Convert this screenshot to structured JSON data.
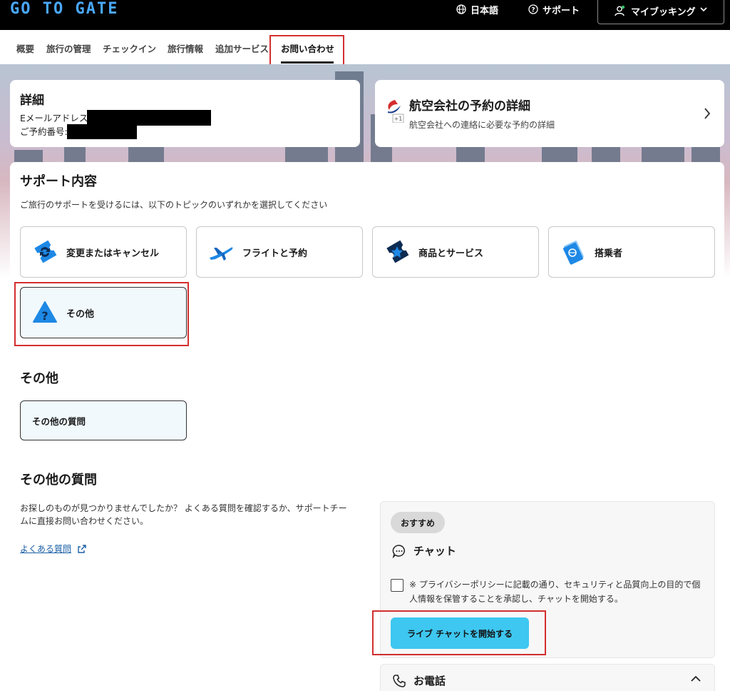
{
  "header": {
    "logo": "GO TO GATE",
    "language": "日本語",
    "support": "サポート",
    "my_booking": "マイブッキング"
  },
  "nav": {
    "items": [
      "概要",
      "旅行の管理",
      "チェックイン",
      "旅行情報",
      "追加サービス",
      "お問い合わせ"
    ],
    "active_index": 5
  },
  "details": {
    "title": "詳細",
    "email_label": "Eメールアドレス",
    "booking_label": "ご予約番号:"
  },
  "airline": {
    "title": "航空会社の予約の詳細",
    "subtitle": "航空会社への連絡に必要な予約の詳細",
    "badge": "+1"
  },
  "support": {
    "title": "サポート内容",
    "description": "ご旅行のサポートを受けるには、以下のトピックのいずれかを選択してください",
    "topics": [
      {
        "label": "変更またはキャンセル",
        "icon": "ticket-change-icon"
      },
      {
        "label": "フライトと予約",
        "icon": "airplane-icon"
      },
      {
        "label": "商品とサービス",
        "icon": "ticket-star-icon"
      },
      {
        "label": "搭乗者",
        "icon": "passport-icon"
      },
      {
        "label": "その他",
        "icon": "question-triangle-icon",
        "selected": true
      }
    ]
  },
  "other": {
    "heading": "その他",
    "subtopic": "その他の質問"
  },
  "other_questions": {
    "heading": "その他の質問",
    "description_line1": "お探しのものが見つかりませんでしたか？ よくある質問を確認するか、サポートチー",
    "description_line2": "ムに直接お問い合わせください。",
    "faq_link": "よくある質問"
  },
  "chat": {
    "badge": "おすすめ",
    "title": "チャット",
    "consent": "※ プライバシーポリシーに記載の通り、セキュリティと品質向上の目的で個人情報を保管することを承認し、チャットを開始する。",
    "button": "ライブ チャットを開始する"
  },
  "phone": {
    "title": "お電話"
  },
  "colors": {
    "accent": "#3ec7f0",
    "highlight": "#d32f2f",
    "icon_blue": "#1e88e5"
  }
}
